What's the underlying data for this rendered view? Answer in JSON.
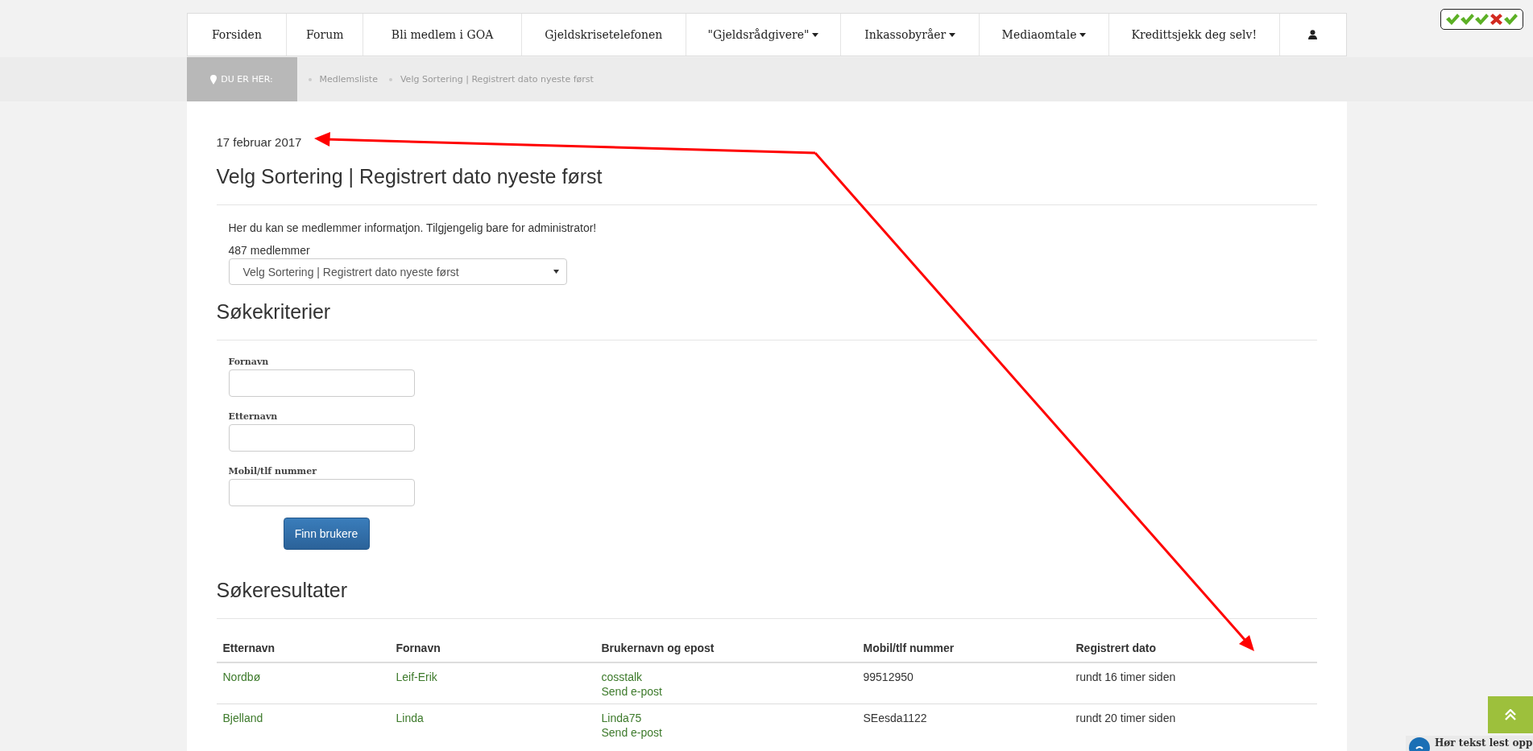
{
  "nav": {
    "items": [
      {
        "label": "Forsiden",
        "kind": "link"
      },
      {
        "label": "Forum",
        "kind": "link"
      },
      {
        "label": "Bli medlem i GOA",
        "kind": "link"
      },
      {
        "label": "Gjeldskrisetelefonen",
        "kind": "link"
      },
      {
        "label": "\"Gjeldsrådgivere\"",
        "kind": "dropdown"
      },
      {
        "label": "Inkassobyråer",
        "kind": "dropdown"
      },
      {
        "label": "Mediaomtale",
        "kind": "dropdown"
      },
      {
        "label": "Kredittsjekk deg selv!",
        "kind": "link"
      },
      {
        "kind": "user"
      }
    ]
  },
  "rating_marks": [
    {
      "kind": "check"
    },
    {
      "kind": "check"
    },
    {
      "kind": "check"
    },
    {
      "kind": "cross"
    },
    {
      "kind": "check"
    }
  ],
  "breadcrumb": {
    "label": "DU ER HER:",
    "items": [
      "Medlemsliste",
      "Velg Sortering | Registrert dato nyeste først"
    ]
  },
  "date": "17 februar 2017",
  "title": "Velg Sortering | Registrert dato nyeste først",
  "intro": "Her du kan se medlemmer informatjon. Tilgjengelig bare for administrator!",
  "count": "487 medlemmer",
  "sort_select": {
    "value": "Velg Sortering | Registrert dato nyeste først"
  },
  "search": {
    "heading": "Søkekriterier",
    "fields": [
      {
        "label": "Fornavn"
      },
      {
        "label": "Etternavn"
      },
      {
        "label": "Mobil/tlf nummer"
      }
    ],
    "button": "Finn brukere"
  },
  "results": {
    "heading": "Søkeresultater",
    "columns": [
      "Etternavn",
      "Fornavn",
      "Brukernavn og epost",
      "Mobil/tlf nummer",
      "Registrert dato"
    ],
    "rows": [
      {
        "last": "Nordbø",
        "first": "Leif-Erik",
        "username": "cosstalk",
        "email_link": "Send e-post",
        "phone": "99512950",
        "registered": "rundt 16 timer siden"
      },
      {
        "last": "Bjelland",
        "first": "Linda",
        "username": "Linda75",
        "email_link": "Send e-post",
        "phone": "SEesda1122",
        "registered": "rundt 20 timer siden"
      }
    ]
  },
  "listen_widget": {
    "label": "Hør tekst lest opp"
  }
}
